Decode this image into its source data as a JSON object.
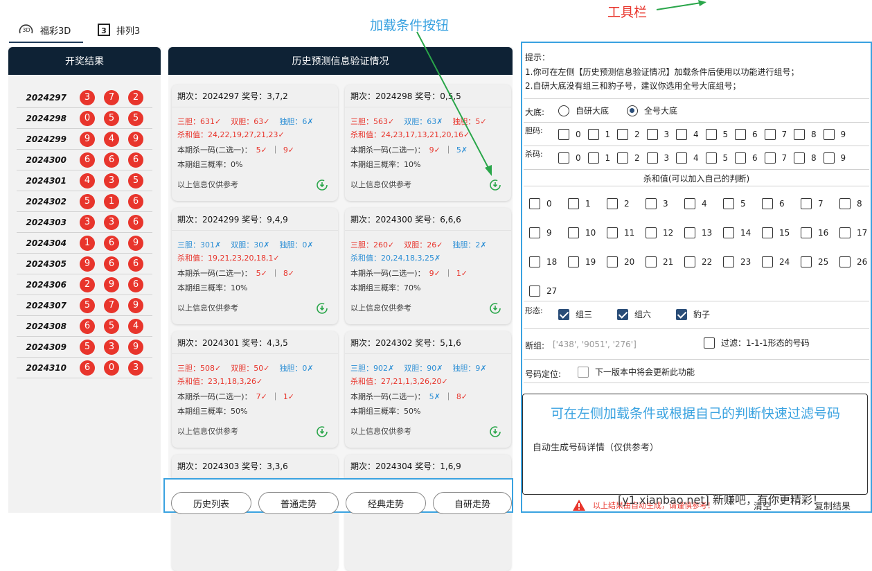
{
  "tabs": [
    {
      "label": "福彩3D",
      "icon": "3d-icon"
    },
    {
      "label": "排列3",
      "icon": "pl3-icon"
    }
  ],
  "left_panel": {
    "title": "开奖结果",
    "draws": [
      {
        "period": "2024297",
        "nums": [
          "3",
          "7",
          "2"
        ]
      },
      {
        "period": "2024298",
        "nums": [
          "0",
          "5",
          "5"
        ]
      },
      {
        "period": "2024299",
        "nums": [
          "9",
          "4",
          "9"
        ]
      },
      {
        "period": "2024300",
        "nums": [
          "6",
          "6",
          "6"
        ]
      },
      {
        "period": "2024301",
        "nums": [
          "4",
          "3",
          "5"
        ]
      },
      {
        "period": "2024302",
        "nums": [
          "5",
          "1",
          "6"
        ]
      },
      {
        "period": "2024303",
        "nums": [
          "3",
          "3",
          "6"
        ]
      },
      {
        "period": "2024304",
        "nums": [
          "1",
          "6",
          "9"
        ]
      },
      {
        "period": "2024305",
        "nums": [
          "9",
          "6",
          "6"
        ]
      },
      {
        "period": "2024306",
        "nums": [
          "2",
          "9",
          "6"
        ]
      },
      {
        "period": "2024307",
        "nums": [
          "5",
          "7",
          "9"
        ]
      },
      {
        "period": "2024308",
        "nums": [
          "6",
          "5",
          "4"
        ]
      },
      {
        "period": "2024309",
        "nums": [
          "5",
          "3",
          "9"
        ]
      },
      {
        "period": "2024310",
        "nums": [
          "6",
          "0",
          "3"
        ]
      }
    ]
  },
  "mid_panel": {
    "title": "历史预测信息验证情况",
    "footer_note": "以上信息仅供参考",
    "cards": [
      {
        "head": "期次：2024297  奖号：3,7,2",
        "l1": [
          [
            "red",
            "三胆：631✓"
          ],
          [
            "red",
            "双胆：63✓"
          ],
          [
            "blue",
            "独胆：6✗"
          ]
        ],
        "l2": [
          [
            "red",
            "杀和值：24,22,19,27,21,23✓"
          ]
        ],
        "l3": [
          [
            "dark",
            "本期杀一码(二选一)："
          ],
          [
            "red",
            "5✓"
          ],
          [
            "dark",
            "｜"
          ],
          [
            "red",
            "9✓"
          ]
        ],
        "l4": "本期组三概率：0%"
      },
      {
        "head": "期次：2024298  奖号：0,5,5",
        "l1": [
          [
            "red",
            "三胆：563✓"
          ],
          [
            "blue",
            "双胆：63✗"
          ],
          [
            "red",
            "独胆：5✓"
          ]
        ],
        "l2": [
          [
            "red",
            "杀和值：24,23,17,13,21,20,16✓"
          ]
        ],
        "l3": [
          [
            "dark",
            "本期杀一码(二选一)："
          ],
          [
            "red",
            "9✓"
          ],
          [
            "dark",
            "｜"
          ],
          [
            "blue",
            "5✗"
          ]
        ],
        "l4": "本期组三概率：10%"
      },
      {
        "head": "期次：2024299  奖号：9,4,9",
        "l1": [
          [
            "blue",
            "三胆：301✗"
          ],
          [
            "blue",
            "双胆：30✗"
          ],
          [
            "blue",
            "独胆：0✗"
          ]
        ],
        "l2": [
          [
            "red",
            "杀和值：19,21,23,20,18,1✓"
          ]
        ],
        "l3": [
          [
            "dark",
            "本期杀一码(二选一)："
          ],
          [
            "red",
            "5✓"
          ],
          [
            "dark",
            "｜"
          ],
          [
            "red",
            "8✓"
          ]
        ],
        "l4": "本期组三概率：10%"
      },
      {
        "head": "期次：2024300  奖号：6,6,6",
        "l1": [
          [
            "red",
            "三胆：260✓"
          ],
          [
            "red",
            "双胆：26✓"
          ],
          [
            "blue",
            "独胆：2✗"
          ]
        ],
        "l2": [
          [
            "blue",
            "杀和值：20,24,18,3,25✗"
          ]
        ],
        "l3": [
          [
            "dark",
            "本期杀一码(二选一)："
          ],
          [
            "red",
            "9✓"
          ],
          [
            "dark",
            "｜"
          ],
          [
            "red",
            "1✓"
          ]
        ],
        "l4": "本期组三概率：70%"
      },
      {
        "head": "期次：2024301  奖号：4,3,5",
        "l1": [
          [
            "red",
            "三胆：508✓"
          ],
          [
            "red",
            "双胆：50✓"
          ],
          [
            "blue",
            "独胆：0✗"
          ]
        ],
        "l2": [
          [
            "red",
            "杀和值：23,1,18,3,26✓"
          ]
        ],
        "l3": [
          [
            "dark",
            "本期杀一码(二选一)："
          ],
          [
            "red",
            "7✓"
          ],
          [
            "dark",
            "｜"
          ],
          [
            "red",
            "1✓"
          ]
        ],
        "l4": "本期组三概率：50%"
      },
      {
        "head": "期次：2024302  奖号：5,1,6",
        "l1": [
          [
            "blue",
            "三胆：902✗"
          ],
          [
            "blue",
            "双胆：90✗"
          ],
          [
            "blue",
            "独胆：9✗"
          ]
        ],
        "l2": [
          [
            "red",
            "杀和值：27,21,1,3,26,20✓"
          ]
        ],
        "l3": [
          [
            "dark",
            "本期杀一码(二选一)："
          ],
          [
            "blue",
            "5✗"
          ],
          [
            "dark",
            "｜"
          ],
          [
            "red",
            "8✓"
          ]
        ],
        "l4": "本期组三概率：50%"
      },
      {
        "head": "期次：2024303  奖号：3,3,6"
      },
      {
        "head": "期次：2024304  奖号：1,6,9"
      }
    ],
    "buttons": [
      "历史列表",
      "普通走势",
      "经典走势",
      "自研走势"
    ]
  },
  "right_panel": {
    "tips_title": "提示：",
    "tip1": "1.你可在左侧【历史预测信息验证情况】加载条件后使用以功能进行组号；",
    "tip2": "2.自研大底没有组三和豹子号，建议你选用全号大底组号；",
    "base_label": "大底:",
    "base_options": [
      "自研大底",
      "全号大底"
    ],
    "dan_label": "胆码:",
    "kill_label": "杀码:",
    "digits": [
      "0",
      "1",
      "2",
      "3",
      "4",
      "5",
      "6",
      "7",
      "8",
      "9"
    ],
    "sum_title": "杀和值(可以加入自己的判断)",
    "sums": [
      "0",
      "1",
      "2",
      "3",
      "4",
      "5",
      "6",
      "7",
      "8",
      "9",
      "10",
      "11",
      "12",
      "13",
      "14",
      "15",
      "16",
      "17",
      "18",
      "19",
      "20",
      "21",
      "22",
      "23",
      "24",
      "25",
      "26",
      "27"
    ],
    "shape_label": "形态:",
    "shapes": [
      "组三",
      "组六",
      "豹子"
    ],
    "break_label": "断组:",
    "break_placeholder": "['438', '9051', '276']",
    "filter_label": "过滤：1-1-1形态的号码",
    "pos_label": "号码定位:",
    "pos_option": "下一版本中将会更新此功能",
    "result_title": "自动生成号码详情（仅供参考）",
    "warning": "以上结果由自动生成，请谨慎参考！",
    "clear_button": "清空",
    "copy_button": "复制结果"
  },
  "annotations": {
    "toolbar": "工具栏",
    "load_button": "加载条件按钮",
    "filter_hint": "可在左侧加载条件或根据自己的判断快速过滤号码",
    "watermark": "[y1.xianbao.net] 新赚吧，有你更精彩！"
  },
  "colors": {
    "ball": "#e8352c",
    "header": "#0e2235",
    "accent": "#39a2e0",
    "check": "#2a4d78"
  }
}
